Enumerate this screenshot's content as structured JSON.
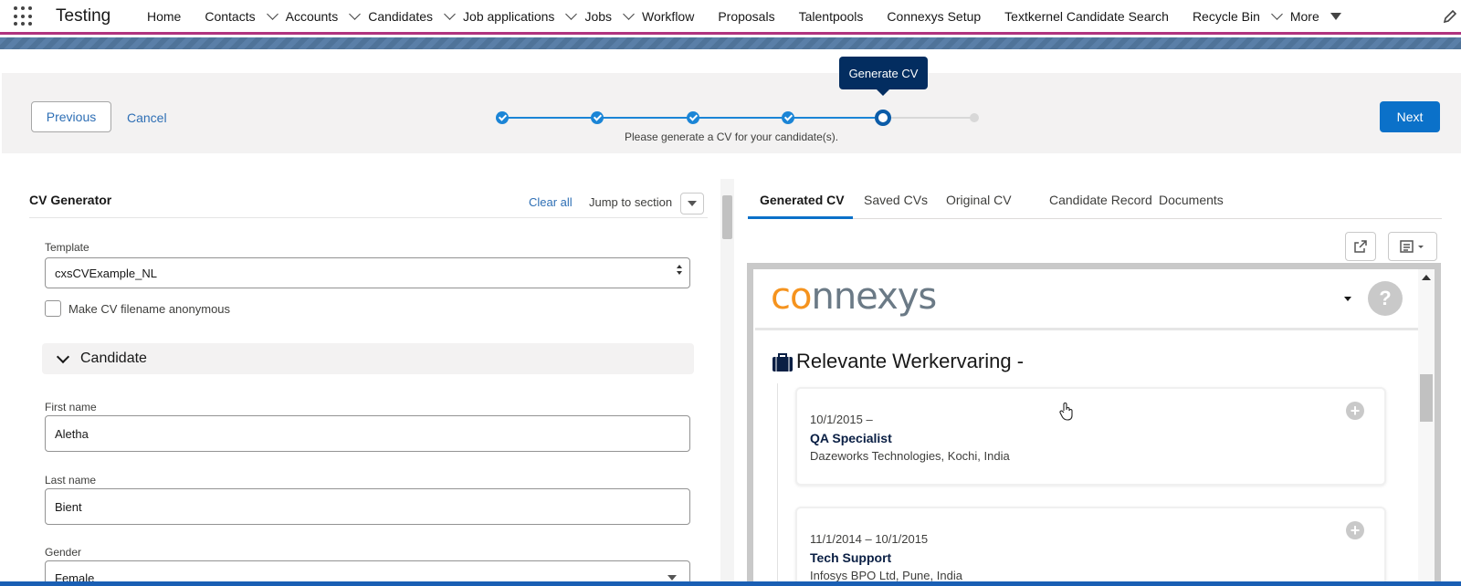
{
  "app": {
    "name": "Testing"
  },
  "nav": {
    "items": [
      {
        "label": "Home",
        "has_menu": false
      },
      {
        "label": "Contacts",
        "has_menu": true
      },
      {
        "label": "Accounts",
        "has_menu": true
      },
      {
        "label": "Candidates",
        "has_menu": true
      },
      {
        "label": "Job applications",
        "has_menu": true
      },
      {
        "label": "Jobs",
        "has_menu": true
      },
      {
        "label": "Workflow",
        "has_menu": false
      },
      {
        "label": "Proposals",
        "has_menu": false
      },
      {
        "label": "Talentpools",
        "has_menu": false
      },
      {
        "label": "Connexys Setup",
        "has_menu": false
      },
      {
        "label": "Textkernel Candidate Search",
        "has_menu": false
      },
      {
        "label": "Recycle Bin",
        "has_menu": true
      },
      {
        "label": "More",
        "has_menu": true
      }
    ],
    "accent_color": "#b0337f"
  },
  "path": {
    "previous_label": "Previous",
    "cancel_label": "Cancel",
    "next_label": "Next",
    "tooltip": "Generate CV",
    "message": "Please generate a CV for your candidate(s).",
    "completed_steps": 4,
    "total_steps": 6,
    "current_step": 5
  },
  "cv_generator": {
    "title": "CV Generator",
    "clear_all": "Clear all",
    "jump_to_section": "Jump to section",
    "template_label": "Template",
    "template_value": "cxsCVExample_NL",
    "anonymous_label": "Make CV filename anonymous",
    "anonymous_checked": false,
    "section_title": "Candidate",
    "first_name_label": "First name",
    "first_name_value": "Aletha",
    "last_name_label": "Last name",
    "last_name_value": "Bient",
    "gender_label": "Gender",
    "gender_value": "Female"
  },
  "tabs": {
    "items": [
      "Generated CV",
      "Saved CVs",
      "Original CV",
      "Candidate Record",
      "Documents"
    ],
    "active": "Generated CV"
  },
  "preview": {
    "logo_prefix": "co",
    "logo_suffix": "nnexys",
    "help_symbol": "?",
    "section_heading": "Relevante Werkervaring -",
    "jobs": [
      {
        "dates": "10/1/2015  –",
        "title": "QA Specialist",
        "company": "Dazeworks Technologies, Kochi, India"
      },
      {
        "dates": "11/1/2014  – 10/1/2015",
        "title": "Tech Support",
        "company": "Infosys BPO Ltd, Pune, India"
      }
    ]
  },
  "colors": {
    "brand_blue": "#0b71c9",
    "link_blue": "#2e6fb5",
    "tooltip_navy": "#032d60",
    "logo_orange": "#f5931e"
  }
}
